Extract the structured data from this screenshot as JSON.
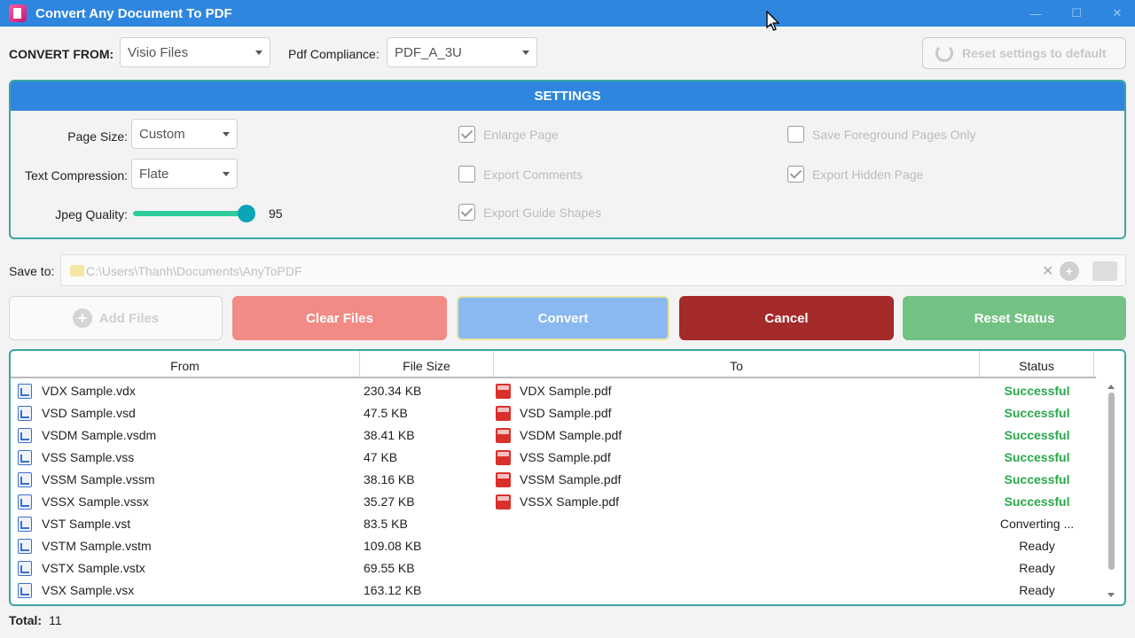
{
  "window": {
    "title": "Convert Any Document To PDF"
  },
  "top": {
    "convert_from_label": "CONVERT FROM:",
    "convert_from_value": "Visio Files",
    "compliance_label": "Pdf Compliance:",
    "compliance_value": "PDF_A_3U",
    "reset_default_label": "Reset settings to default"
  },
  "settings": {
    "header": "SETTINGS",
    "page_size_label": "Page Size:",
    "page_size_value": "Custom",
    "text_compression_label": "Text Compression:",
    "text_compression_value": "Flate",
    "jpeg_quality_label": "Jpeg Quality:",
    "jpeg_quality_value": "95",
    "checkboxes": [
      {
        "label": "Enlarge Page",
        "checked": true
      },
      {
        "label": "Export Comments",
        "checked": false
      },
      {
        "label": "Export Guide Shapes",
        "checked": true
      },
      {
        "label": "Save Foreground Pages Only",
        "checked": false
      },
      {
        "label": "Export Hidden Page",
        "checked": true
      }
    ]
  },
  "save": {
    "label": "Save to:",
    "path": "C:\\Users\\Thanh\\Documents\\AnyToPDF"
  },
  "buttons": {
    "add_files": "Add Files",
    "clear_files": "Clear Files",
    "convert": "Convert",
    "cancel": "Cancel",
    "reset_status": "Reset Status"
  },
  "table": {
    "headers": [
      "From",
      "File Size",
      "To",
      "Status"
    ],
    "rows": [
      {
        "from": "VDX Sample.vdx",
        "size": "230.34 KB",
        "to": "VDX Sample.pdf",
        "status": "Successful"
      },
      {
        "from": "VSD Sample.vsd",
        "size": "47.5 KB",
        "to": "VSD Sample.pdf",
        "status": "Successful"
      },
      {
        "from": "VSDM Sample.vsdm",
        "size": "38.41 KB",
        "to": "VSDM Sample.pdf",
        "status": "Successful"
      },
      {
        "from": "VSS Sample.vss",
        "size": "47 KB",
        "to": "VSS Sample.pdf",
        "status": "Successful"
      },
      {
        "from": "VSSM Sample.vssm",
        "size": "38.16 KB",
        "to": "VSSM Sample.pdf",
        "status": "Successful"
      },
      {
        "from": "VSSX Sample.vssx",
        "size": "35.27 KB",
        "to": "VSSX Sample.pdf",
        "status": "Successful"
      },
      {
        "from": "VST Sample.vst",
        "size": "83.5 KB",
        "to": "",
        "status": "Converting ..."
      },
      {
        "from": "VSTM Sample.vstm",
        "size": "109.08 KB",
        "to": "",
        "status": "Ready"
      },
      {
        "from": "VSTX Sample.vstx",
        "size": "69.55 KB",
        "to": "",
        "status": "Ready"
      },
      {
        "from": "VSX Sample.vsx",
        "size": "163.12 KB",
        "to": "",
        "status": "Ready"
      }
    ]
  },
  "footer": {
    "total_label": "Total:",
    "total_value": "11"
  }
}
